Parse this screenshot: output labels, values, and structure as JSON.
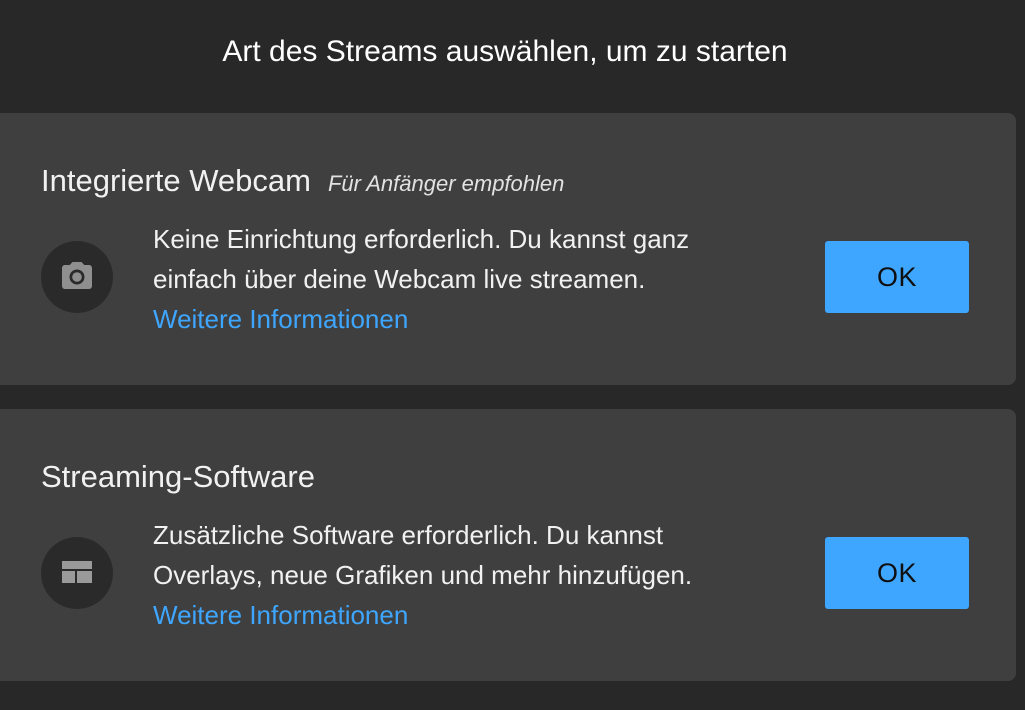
{
  "header": {
    "title": "Art des Streams auswählen, um zu starten"
  },
  "options": [
    {
      "title": "Integrierte Webcam",
      "badge": "Für Anfänger empfohlen",
      "icon": "camera-icon",
      "description": "Keine Einrichtung erforderlich. Du kannst ganz einfach über deine Webcam live streamen.",
      "link_label": "Weitere Informationen",
      "button_label": "OK"
    },
    {
      "title": "Streaming-Software",
      "badge": "",
      "icon": "layout-icon",
      "description": "Zusätzliche Software erforderlich. Du kannst Overlays, neue Grafiken und mehr hinzufügen.",
      "link_label": "Weitere Informationen",
      "button_label": "OK"
    }
  ],
  "colors": {
    "background": "#282828",
    "card": "#3f3f3f",
    "accent": "#3ea6ff",
    "icon_circle": "#2a2a2a"
  }
}
